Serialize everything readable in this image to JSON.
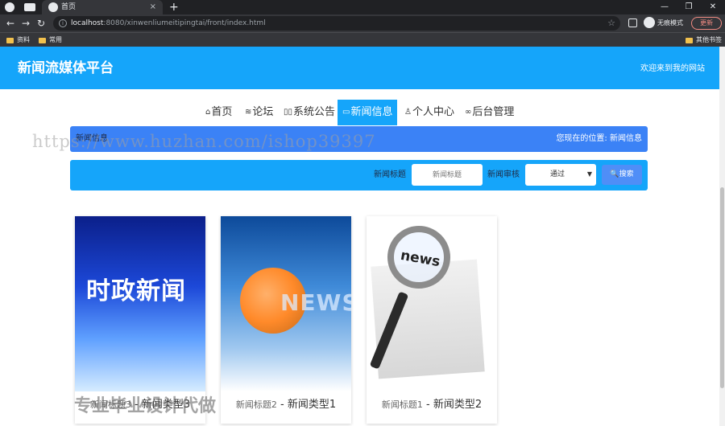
{
  "browser": {
    "tab_title": "首页",
    "tab_close": "×",
    "new_tab": "+",
    "url_host": "localhost",
    "url_rest": ":8080/xinwenliumeitipingtai/front/index.html",
    "profile_label": "无痕模式",
    "update_label": "更新",
    "bookmarks": [
      "资料",
      "常用",
      "其他书签"
    ],
    "window_controls": [
      "—",
      "❐",
      "✕"
    ]
  },
  "site": {
    "title": "新闻流媒体平台",
    "welcome": "欢迎来到我的网站"
  },
  "nav": {
    "items": [
      {
        "icon": "⌂",
        "label": "首页"
      },
      {
        "icon": "≋",
        "label": "论坛"
      },
      {
        "icon": "▯▯",
        "label": "系统公告"
      },
      {
        "icon": "▭",
        "label": "新闻信息"
      },
      {
        "icon": "♙",
        "label": "个人中心"
      },
      {
        "icon": "∞",
        "label": "后台管理"
      }
    ]
  },
  "info_bar": {
    "section": "新闻信息",
    "location_prefix": "您现在的位置:",
    "location": "新闻信息"
  },
  "search": {
    "title_label": "新闻标题",
    "title_placeholder": "新闻标题",
    "audit_label": "新闻审核",
    "audit_value": "通过",
    "search_button": "搜索"
  },
  "cards": [
    {
      "title": "新闻标题3",
      "type": "- 新闻类型3",
      "image_text": "时政新闻"
    },
    {
      "title": "新闻标题2",
      "type": "- 新闻类型1",
      "image_text": "NEWS"
    },
    {
      "title": "新闻标题1",
      "type": "- 新闻类型2",
      "image_text": "news"
    }
  ],
  "watermarks": {
    "url": "https://www.huzhan.com/ishop39397",
    "bottom": "专业毕业设计代做"
  },
  "colors": {
    "header": "#15a5fa",
    "info_bar": "#3b82f6",
    "search_button": "#4f8ef7"
  }
}
